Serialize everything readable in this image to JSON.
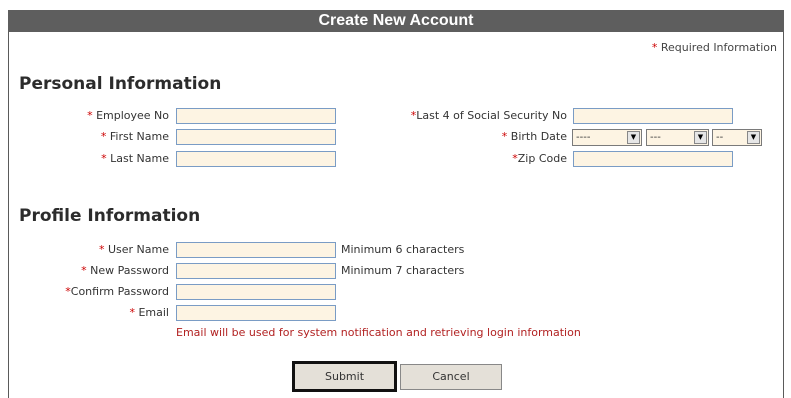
{
  "header": {
    "title": "Create New Account"
  },
  "required_note": {
    "star": "*",
    "text": "Required Information"
  },
  "personal": {
    "title": "Personal Information",
    "fields": {
      "employee_no": {
        "star": "*",
        "label": "Employee No",
        "value": ""
      },
      "first_name": {
        "star": "*",
        "label": "First Name",
        "value": ""
      },
      "last_name": {
        "star": "*",
        "label": "Last Name",
        "value": ""
      },
      "ssn_last4": {
        "star": "*",
        "label": "Last 4 of Social Security No",
        "value": ""
      },
      "birth_date": {
        "star": "*",
        "label": "Birth Date",
        "month": "----",
        "day": "---",
        "year": "--"
      },
      "zip": {
        "star": "*",
        "label": "Zip Code",
        "value": ""
      }
    }
  },
  "profile": {
    "title": "Profile Information",
    "fields": {
      "user_name": {
        "star": "*",
        "label": "User Name",
        "value": "",
        "hint": "Minimum 6 characters"
      },
      "new_password": {
        "star": "*",
        "label": "New Password",
        "value": "",
        "hint": "Minimum 7 characters"
      },
      "confirm_password": {
        "star": "*",
        "label": "Confirm Password",
        "value": ""
      },
      "email": {
        "star": "*",
        "label": "Email",
        "value": ""
      }
    },
    "email_note": "Email will be used for system notification and retrieving login information"
  },
  "actions": {
    "submit": "Submit",
    "cancel": "Cancel"
  },
  "colors": {
    "title_bar": "#5e5e5e",
    "required": "#cc0000",
    "input_bg": "#fdf4e3",
    "input_border": "#7a9cc5"
  }
}
